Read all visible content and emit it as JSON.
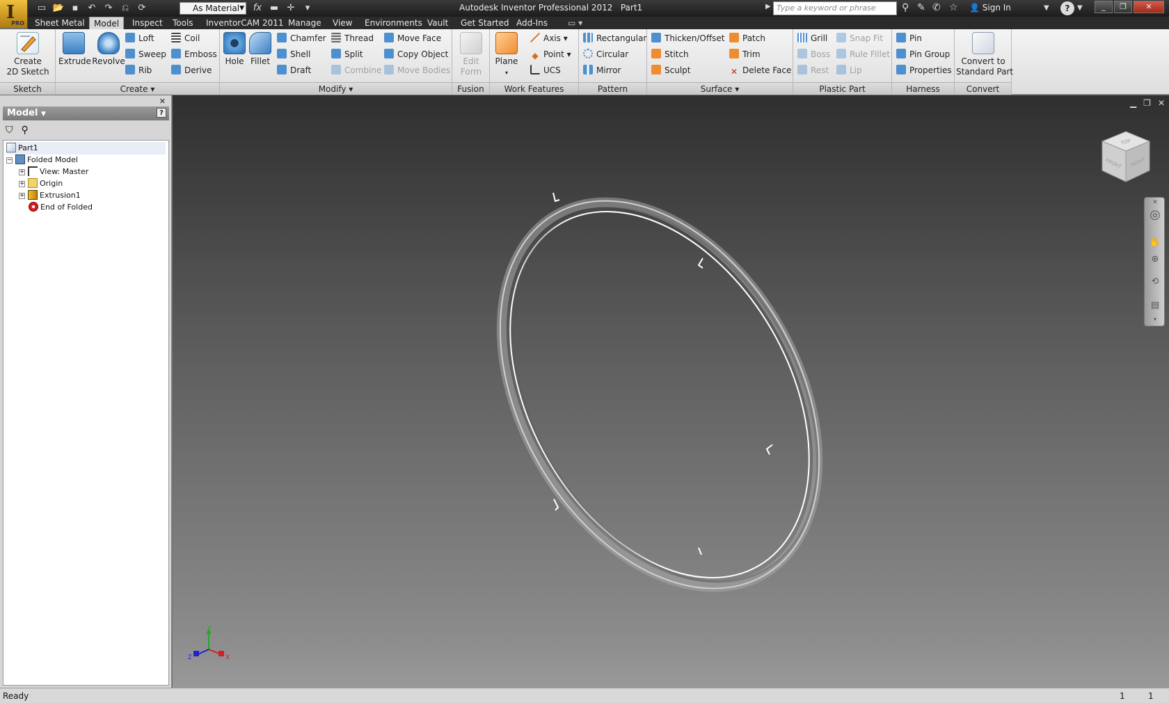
{
  "titlebar": {
    "material": "As Material",
    "title": "Autodesk Inventor Professional 2012",
    "document": "Part1",
    "search_placeholder": "Type a keyword or phrase",
    "sign_in": "Sign In",
    "pro_badge": "PRO"
  },
  "tabs": [
    "Sheet Metal",
    "Model",
    "Inspect",
    "Tools",
    "InventorCAM 2011",
    "Manage",
    "View",
    "Environments",
    "Vault",
    "Get Started",
    "Add-Ins"
  ],
  "active_tab": "Model",
  "ribbon": {
    "sketch": {
      "label": "Sketch",
      "create_2d_sketch": [
        "Create",
        "2D Sketch"
      ]
    },
    "create": {
      "label": "Create",
      "extrude": "Extrude",
      "revolve": "Revolve",
      "loft": "Loft",
      "sweep": "Sweep",
      "rib": "Rib",
      "coil": "Coil",
      "emboss": "Emboss",
      "derive": "Derive"
    },
    "modify": {
      "label": "Modify",
      "hole": "Hole",
      "fillet": "Fillet",
      "chamfer": "Chamfer",
      "shell": "Shell",
      "draft": "Draft",
      "thread": "Thread",
      "split": "Split",
      "combine": "Combine",
      "move_face": "Move Face",
      "copy_object": "Copy Object",
      "move_bodies": "Move Bodies"
    },
    "fusion": {
      "label": "Fusion",
      "edit_form": [
        "Edit",
        "Form"
      ]
    },
    "work_features": {
      "label": "Work Features",
      "plane": "Plane",
      "axis": "Axis",
      "point": "Point",
      "ucs": "UCS"
    },
    "pattern": {
      "label": "Pattern",
      "rectangular": "Rectangular",
      "circular": "Circular",
      "mirror": "Mirror"
    },
    "surface": {
      "label": "Surface",
      "thicken_offset": "Thicken/Offset",
      "stitch": "Stitch",
      "sculpt": "Sculpt",
      "patch": "Patch",
      "trim": "Trim",
      "delete_face": "Delete Face"
    },
    "plastic_part": {
      "label": "Plastic Part",
      "grill": "Grill",
      "boss": "Boss",
      "rest": "Rest",
      "snap_fit": "Snap Fit",
      "rule_fillet": "Rule Fillet",
      "lip": "Lip"
    },
    "harness": {
      "label": "Harness",
      "pin": "Pin",
      "pin_group": "Pin Group",
      "properties": "Properties"
    },
    "convert": {
      "label": "Convert",
      "convert_to_standard_part": [
        "Convert to",
        "Standard Part"
      ]
    }
  },
  "browser": {
    "title": "Model",
    "tree": [
      "Part1",
      "Folded Model",
      "View: Master",
      "Origin",
      "Extrusion1",
      "End of Folded"
    ]
  },
  "viewcube": {
    "top": "TOP",
    "front": "FRONT",
    "right": "RIGHT"
  },
  "triad": {
    "x": "X",
    "y": "Y",
    "z": "Z"
  },
  "status": {
    "text": "Ready",
    "n1": "1",
    "n2": "1"
  },
  "colors": {
    "accent_tab": "#d9d9d9",
    "viewport_top": "#2f2f2f",
    "viewport_bottom": "#999999"
  }
}
